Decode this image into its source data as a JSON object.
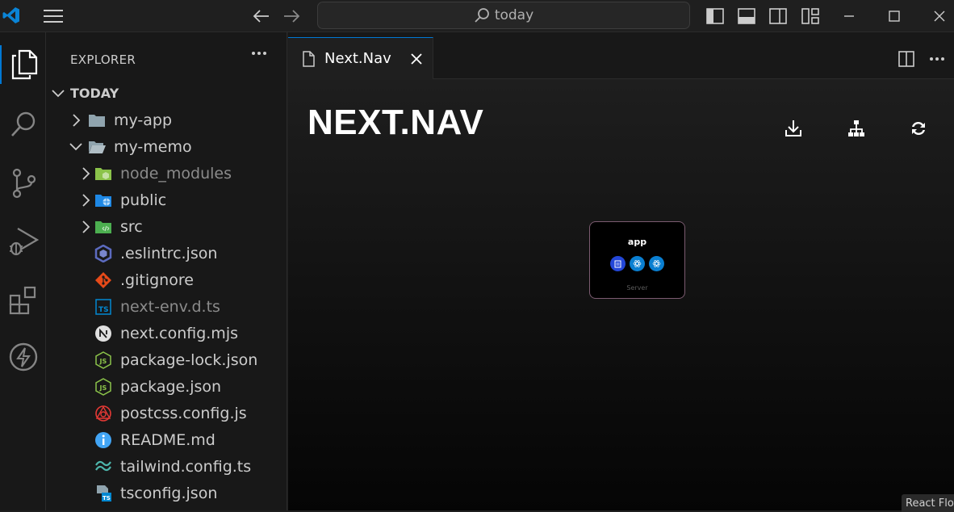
{
  "titlebar": {
    "search_text": "today"
  },
  "sidebar": {
    "header": "EXPLORER",
    "root_label": "TODAY",
    "items": [
      {
        "label": "my-app",
        "kind": "folder",
        "indent": 1,
        "state": "collapsed",
        "icon": "folder-icon"
      },
      {
        "label": "my-memo",
        "kind": "folder",
        "indent": 1,
        "state": "expanded",
        "icon": "folder-open-icon"
      },
      {
        "label": "node_modules",
        "kind": "folder",
        "indent": 2,
        "state": "collapsed",
        "icon": "node-folder-icon",
        "dim": true
      },
      {
        "label": "public",
        "kind": "folder",
        "indent": 2,
        "state": "collapsed",
        "icon": "public-folder-icon"
      },
      {
        "label": "src",
        "kind": "folder",
        "indent": 2,
        "state": "collapsed",
        "icon": "src-folder-icon"
      },
      {
        "label": ".eslintrc.json",
        "kind": "file",
        "indent": 2,
        "icon": "eslint-icon"
      },
      {
        "label": ".gitignore",
        "kind": "file",
        "indent": 2,
        "icon": "git-icon"
      },
      {
        "label": "next-env.d.ts",
        "kind": "file",
        "indent": 2,
        "icon": "typescript-icon",
        "dim": true
      },
      {
        "label": "next.config.mjs",
        "kind": "file",
        "indent": 2,
        "icon": "next-icon"
      },
      {
        "label": "package-lock.json",
        "kind": "file",
        "indent": 2,
        "icon": "nodejs-icon"
      },
      {
        "label": "package.json",
        "kind": "file",
        "indent": 2,
        "icon": "nodejs-icon"
      },
      {
        "label": "postcss.config.js",
        "kind": "file",
        "indent": 2,
        "icon": "postcss-icon"
      },
      {
        "label": "README.md",
        "kind": "file",
        "indent": 2,
        "icon": "info-icon"
      },
      {
        "label": "tailwind.config.ts",
        "kind": "file",
        "indent": 2,
        "icon": "tailwind-icon"
      },
      {
        "label": "tsconfig.json",
        "kind": "file",
        "indent": 2,
        "icon": "tsconfig-icon"
      }
    ]
  },
  "tabs": [
    {
      "label": "Next.Nav",
      "active": true
    }
  ],
  "editor": {
    "title": "NEXT.NAV",
    "node": {
      "title": "app",
      "subtitle": "Server"
    },
    "attribution": "React Flow"
  },
  "colors": {
    "accent": "#0078d4",
    "node_border": "#7b5b70"
  }
}
